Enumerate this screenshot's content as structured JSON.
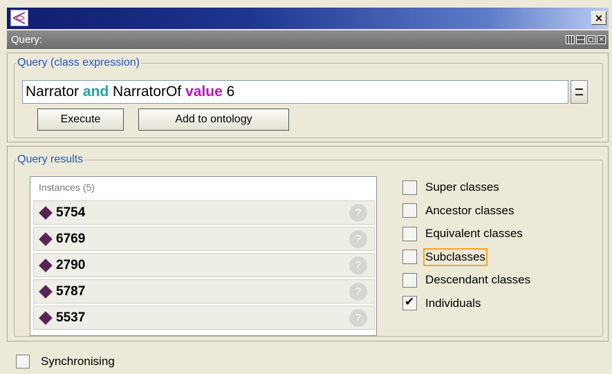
{
  "window": {
    "close_glyph": "×"
  },
  "view": {
    "title": "Query:"
  },
  "query": {
    "group_label": "Query (class expression)",
    "expression": [
      {
        "text": "Narrator ",
        "kind": "plain"
      },
      {
        "text": "and",
        "kind": "keyword-and"
      },
      {
        "text": " NarratorOf ",
        "kind": "plain"
      },
      {
        "text": "value",
        "kind": "keyword-value"
      },
      {
        "text": " 6",
        "kind": "plain"
      }
    ],
    "execute_label": "Execute",
    "add_label": "Add to ontology"
  },
  "results": {
    "group_label": "Query results",
    "instances_header": "Instances (5)",
    "instances": [
      "5754",
      "6769",
      "2790",
      "5787",
      "5537"
    ],
    "help_glyph": "?"
  },
  "options": [
    {
      "label": "Super classes",
      "checked": false,
      "focused": false
    },
    {
      "label": "Ancestor classes",
      "checked": false,
      "focused": false
    },
    {
      "label": "Equivalent classes",
      "checked": false,
      "focused": false
    },
    {
      "label": "Subclasses",
      "checked": false,
      "focused": true
    },
    {
      "label": "Descendant classes",
      "checked": false,
      "focused": false
    },
    {
      "label": "Individuals",
      "checked": true,
      "focused": false
    }
  ],
  "sync": {
    "label": "Synchronising",
    "checked": false
  },
  "colors": {
    "keyword_and": "#27a3a3",
    "keyword_value": "#b01ab0",
    "instance_icon": "#5a2456",
    "focus_outline": "#f5a623"
  }
}
